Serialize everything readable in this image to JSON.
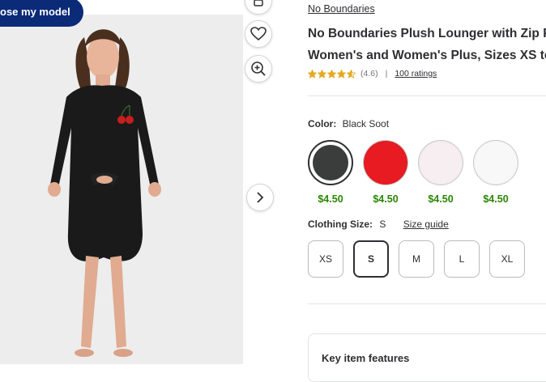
{
  "image_panel": {
    "choose_model_label": "ose my model"
  },
  "product": {
    "brand": "No Boundaries",
    "title_line1": "No Boundaries Plush Lounger with Zip P",
    "title_line2": "Women's and Women's Plus, Sizes XS to",
    "rating": "(4.6)",
    "rating_value": 4.6,
    "ratings_count": "100 ratings",
    "separator": "|"
  },
  "color": {
    "label": "Color:",
    "selected": "Black Soot",
    "swatches": [
      {
        "name": "black-soot",
        "price": "$4.50",
        "color": "#3a3d3b",
        "selected": true
      },
      {
        "name": "red",
        "price": "$4.50",
        "color": "#e81a22",
        "selected": false
      },
      {
        "name": "pink-white",
        "price": "$4.50",
        "color": "#f7eef1",
        "selected": false
      },
      {
        "name": "white",
        "price": "$4.50",
        "color": "#f8f8f8",
        "selected": false
      }
    ]
  },
  "size": {
    "label": "Clothing Size:",
    "selected": "S",
    "guide_link": "Size guide",
    "options": [
      "XS",
      "S",
      "M",
      "L",
      "XL"
    ]
  },
  "features": {
    "title": "Key item features"
  },
  "colors": {
    "navy": "#0b2a78",
    "price_green": "#2a8703",
    "star_gold": "#e5a823"
  },
  "icons": [
    "heart-icon",
    "zoom-in-icon",
    "chevron-right-icon",
    "share-icon",
    "star-icon"
  ]
}
